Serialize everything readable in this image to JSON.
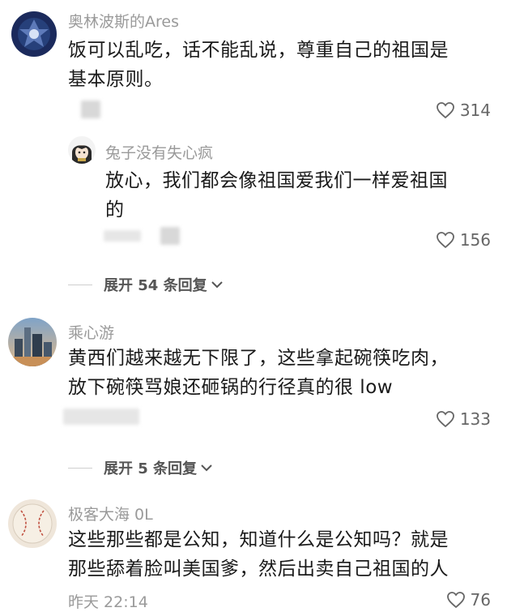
{
  "comments": [
    {
      "username": "奥林波斯的Ares",
      "lines": [
        "饭可以乱吃，话不能乱说，尊重自己的祖国是",
        "基本原则。"
      ],
      "likes": "314",
      "reply": {
        "username": "兔子没有失心疯",
        "lines": [
          "放心，我们都会像祖国爱我们一样爱祖国",
          "的"
        ],
        "likes": "156"
      },
      "expand_label": "展开 54 条回复"
    },
    {
      "username": "乘心游",
      "lines": [
        "黄西们越来越无下限了，这些拿起碗筷吃肉，",
        "放下碗筷骂娘还砸锅的行径真的很 low"
      ],
      "likes": "133",
      "expand_label": "展开 5 条回复"
    },
    {
      "username": "极客大海 0L",
      "lines": [
        "这些那些都是公知，知道什么是公知吗？就是",
        "那些舔着脸叫美国爹，然后出卖自己祖国的人"
      ],
      "time": "昨天 22:14",
      "likes": "76"
    }
  ],
  "icons": {
    "like": "heart-icon",
    "expand": "chevron-down-icon"
  },
  "colors": {
    "text": "#1a1a1a",
    "meta": "#9a9a9a"
  }
}
